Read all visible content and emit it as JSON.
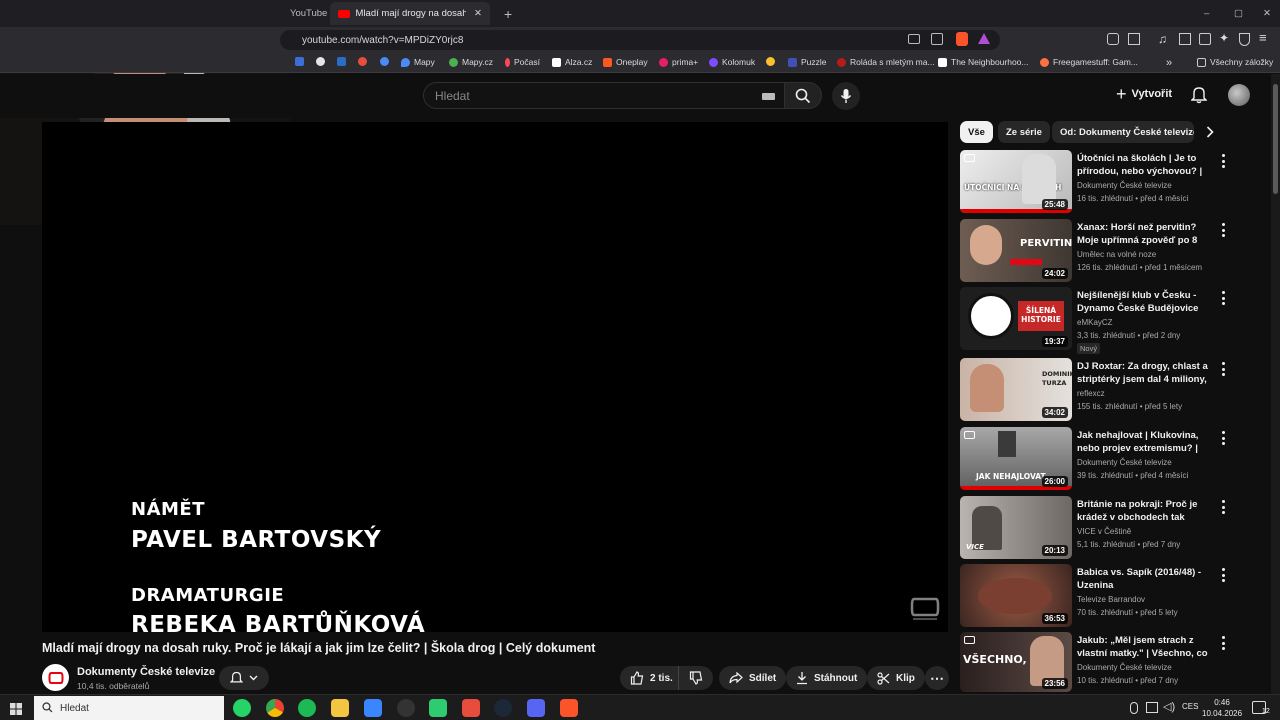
{
  "browser": {
    "tabs": [
      {
        "label": "YouTube",
        "active": false
      },
      {
        "label": "Mladí mají drogy na dosah ruky",
        "active": true
      }
    ],
    "url": "youtube.com/watch?v=MPDiZY0rjc8",
    "bookmarks": [
      {
        "label": "",
        "color": "#3b6fd6"
      },
      {
        "label": "",
        "color": "#e6e6e6"
      },
      {
        "label": "",
        "color": "#2a6dc4"
      },
      {
        "label": "",
        "color": "#e84e3c"
      },
      {
        "label": "Mapy",
        "color": "#4c8bf5"
      },
      {
        "label": "Mapy.cz",
        "color": "#4caf50"
      },
      {
        "label": "Počasí",
        "color": "#ff4757"
      },
      {
        "label": "Alza.cz",
        "color": "#ffffff"
      },
      {
        "label": "Oneplay",
        "color": "#ff5722"
      },
      {
        "label": "prima+",
        "color": "#e91e63"
      },
      {
        "label": "Kolomuk",
        "color": "#7c4dff"
      },
      {
        "label": "",
        "color": "#fbc02d"
      },
      {
        "label": "Puzzle",
        "color": "#3f51b5"
      },
      {
        "label": "Roláda s mletým ma...",
        "color": "#b71c1c"
      },
      {
        "label": "The Neighbourhoo...",
        "color": "#ffffff"
      },
      {
        "label": "Freegamestuff: Gam...",
        "color": "#ff7043"
      }
    ],
    "bookmarks_folder": "Všechny záložky"
  },
  "header": {
    "search_placeholder": "Hledat",
    "create_label": "Vytvořit"
  },
  "player": {
    "credits": [
      {
        "role": "NÁMĚT",
        "name": "PAVEL BARTOVSKÝ"
      },
      {
        "role": "DRAMATURGIE",
        "name": "REBEKA BARTŮŇKOVÁ"
      }
    ]
  },
  "video": {
    "title": "Mladí mají drogy na dosah ruky. Proč je lákají a jak jim lze čelit? | Škola drog | Celý dokument",
    "channel": "Dokumenty České televize",
    "subscribers": "10,4 tis. odběratelů",
    "likes": "2 tis.",
    "share_label": "Sdílet",
    "download_label": "Stáhnout",
    "clip_label": "Klip"
  },
  "chips": [
    "Vše",
    "Ze série",
    "Od: Dokumenty České televize"
  ],
  "recommendations": [
    {
      "title": "Útočníci na školách | Je to přírodou, nebo výchovou? | Cel...",
      "channel": "Dokumenty České televize",
      "meta": "16 tis. zhlédnutí • před 4 měsíci",
      "duration": "25:48",
      "badge": "",
      "thumb_text": "ÚTOČNÍCI NA ŠKOLÁCH",
      "thumb_bg": "#c8c8c8"
    },
    {
      "title": "Xanax: Horší než pervitin? Moje upřímná zpověď po 8 LETECH ...",
      "channel": "Umělec na volné noze",
      "meta": "126 tis. zhlédnutí • před 1 měsícem",
      "duration": "24:02",
      "badge": "",
      "thumb_text": "PERVITIN",
      "thumb_bg": "#5a4b42"
    },
    {
      "title": "Nejšílenější klub v Česku - Dynamo České Budějovice",
      "channel": "eMKayCZ",
      "meta": "3,3 tis. zhlédnutí • před 2 dny",
      "duration": "19:37",
      "badge": "Nový",
      "thumb_text": "ŠÍLENÁ HISTORIE",
      "thumb_bg": "#1e1e1e"
    },
    {
      "title": "DJ Roxtar:  Za drogy, chlast a striptérky jsem dal 4 miliony, b...",
      "channel": "reflexcz",
      "meta": "155 tis. zhlédnutí • před 5 lety",
      "duration": "34:02",
      "badge": "",
      "thumb_text": "DOMINIK TURZA",
      "thumb_bg": "#d9d5d0"
    },
    {
      "title": "Jak nehajlovat | Klukovina, nebo projev extremismu? | Celý ...",
      "channel": "Dokumenty České televize",
      "meta": "39 tis. zhlédnutí • před 4 měsíci",
      "duration": "26:00",
      "badge": "",
      "thumb_text": "JAK NEHAJLOVAT",
      "thumb_bg": "#8a8a8a"
    },
    {
      "title": "Británie na pokraji: Proč je krádež v obchodech tak častá?",
      "channel": "VICE v Češtině",
      "meta": "5,1 tis. zhlédnutí • před 7 dny",
      "duration": "20:13",
      "badge": "",
      "thumb_text": "VICE",
      "thumb_bg": "#9a9590"
    },
    {
      "title": "Babica vs. Sapík (2016/48) - Uzenina",
      "channel": "Televize Barrandov",
      "meta": "70 tis. zhlédnutí • před 5 lety",
      "duration": "36:53",
      "badge": "",
      "thumb_text": "",
      "thumb_bg": "#5c3a2e"
    },
    {
      "title": "Jakub: „Měl jsem strach z vlastní matky.\" | Všechno, co ...",
      "channel": "Dokumenty České televize",
      "meta": "10 tis. zhlédnutí • před 7 dny",
      "duration": "23:56",
      "badge": "",
      "thumb_text": "VŠECHNO,",
      "thumb_bg": "#3a2a2a"
    }
  ],
  "taskbar": {
    "search_placeholder": "Hledat",
    "lang": "CES",
    "time": "0:46",
    "date": "10.04.2026",
    "notif_count": "12"
  }
}
